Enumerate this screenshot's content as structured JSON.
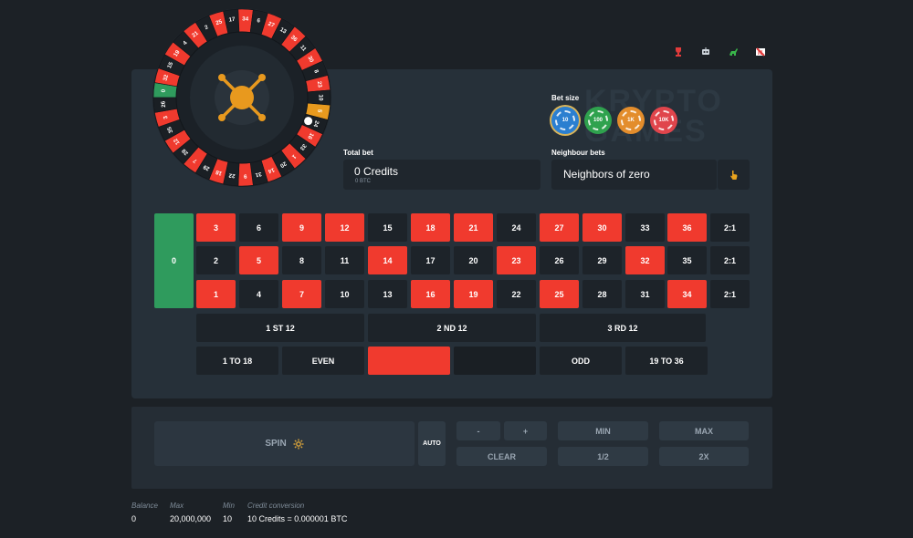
{
  "watermark": [
    "KRYPTO",
    "GAMES"
  ],
  "top_icons": [
    "trophy-icon",
    "robot-icon",
    "dinosaur-icon",
    "mute-icon"
  ],
  "wheel": {
    "numbers": [
      0,
      32,
      15,
      19,
      4,
      21,
      2,
      25,
      17,
      34,
      6,
      27,
      13,
      36,
      11,
      30,
      8,
      23,
      10,
      5,
      24,
      16,
      33,
      1,
      20,
      14,
      31,
      9,
      22,
      18,
      29,
      7,
      28,
      12,
      35,
      3,
      26
    ],
    "red_numbers": [
      1,
      3,
      5,
      7,
      9,
      12,
      14,
      16,
      18,
      19,
      21,
      23,
      25,
      27,
      30,
      32,
      34,
      36
    ],
    "ball_on": 24,
    "highlight": 5
  },
  "bet_size": {
    "label": "Bet size",
    "chips": [
      {
        "label": "10",
        "color": "#2b7fd0",
        "selected": true
      },
      {
        "label": "100",
        "color": "#2fa24e",
        "selected": false
      },
      {
        "label": "1K",
        "color": "#e38d2c",
        "selected": false
      },
      {
        "label": "10K",
        "color": "#e0454c",
        "selected": false
      }
    ]
  },
  "total_bet": {
    "label": "Total bet",
    "value": "0 Credits",
    "sub": "0 BTC"
  },
  "neighbour_bets": {
    "label": "Neighbour bets",
    "value": "Neighbors of zero"
  },
  "table": {
    "zero": "0",
    "rows": [
      [
        3,
        6,
        9,
        12,
        15,
        18,
        21,
        24,
        27,
        30,
        33,
        36
      ],
      [
        2,
        5,
        8,
        11,
        14,
        17,
        20,
        23,
        26,
        29,
        32,
        35
      ],
      [
        1,
        4,
        7,
        10,
        13,
        16,
        19,
        22,
        25,
        28,
        31,
        34
      ]
    ],
    "column_bet": "2:1",
    "dozens": [
      "1 ST 12",
      "2 ND 12",
      "3 RD 12"
    ],
    "outside": [
      "1 TO 18",
      "EVEN",
      "",
      "",
      "ODD",
      "19 TO 36"
    ]
  },
  "controls": {
    "spin": "SPIN",
    "auto": "AUTO",
    "minus": "-",
    "plus": "+",
    "clear": "CLEAR",
    "min": "MIN",
    "half": "1/2",
    "max": "MAX",
    "double": "2X"
  },
  "footer": {
    "balance_label": "Balance",
    "balance": "0",
    "max_label": "Max",
    "max": "20,000,000",
    "min_label": "Min",
    "min": "10",
    "conv_label": "Credit conversion",
    "conv": "10 Credits = 0.000001 BTC"
  },
  "colors": {
    "red": "#f03a2e",
    "black": "#1d2329",
    "green": "#2f9b5d",
    "gold": "#e89a1e"
  }
}
